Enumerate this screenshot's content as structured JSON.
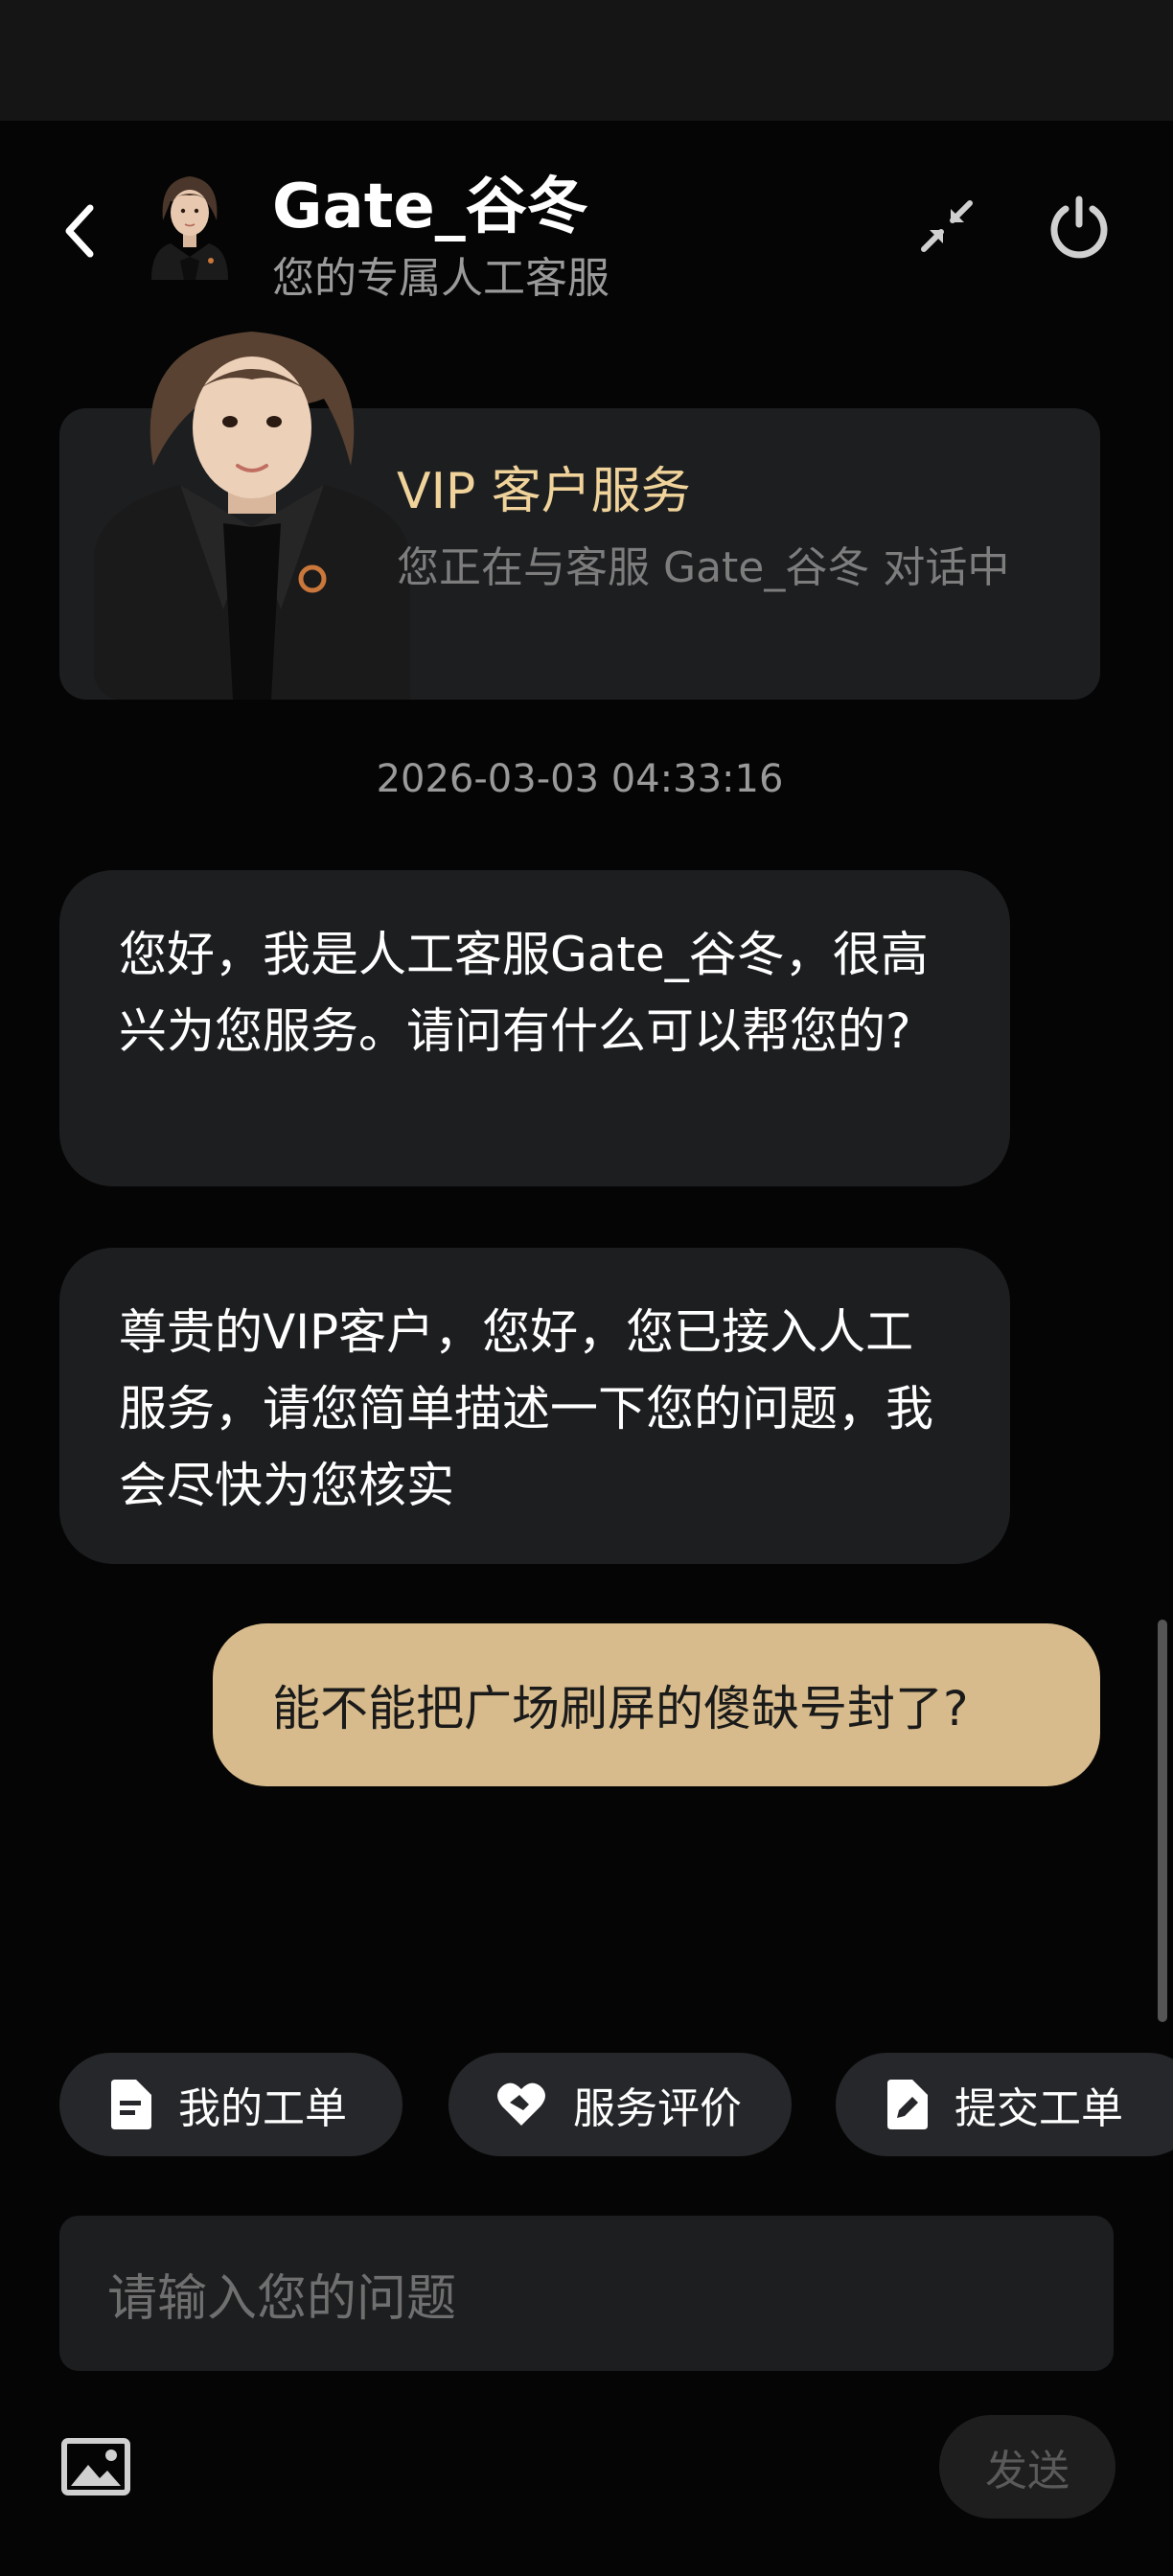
{
  "header": {
    "title": "Gate_谷冬",
    "subtitle": "您的专属人工客服"
  },
  "vip_card": {
    "title": "VIP 客户服务",
    "description": "您正在与客服 Gate_谷冬 对话中"
  },
  "chat": {
    "timestamp": "2026-03-03 04:33:16",
    "messages": [
      {
        "from": "agent",
        "text": "您好，我是人工客服Gate_谷冬，很高兴为您服务。请问有什么可以帮您的?"
      },
      {
        "from": "agent",
        "text": "尊贵的VIP客户，您好，您已接入人工服务，请您简单描述一下您的问题，我会尽快为您核实"
      },
      {
        "from": "user",
        "text": "能不能把广场刷屏的傻缺号封了?"
      }
    ]
  },
  "quick_actions": [
    {
      "label": "我的工单",
      "icon": "document-icon"
    },
    {
      "label": "服务评价",
      "icon": "heart-handshake-icon"
    },
    {
      "label": "提交工单",
      "icon": "edit-document-icon"
    }
  ],
  "composer": {
    "placeholder": "请输入您的问题",
    "send_label": "发送"
  },
  "colors": {
    "background": "#050505",
    "card": "#1d1e20",
    "accent_gold": "#d7bb8c",
    "vip_title": "#f0d39a"
  }
}
